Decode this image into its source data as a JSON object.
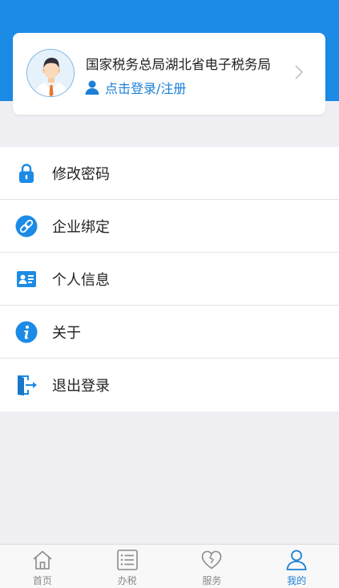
{
  "colors": {
    "brand_blue": "#1b8be6",
    "link_blue": "#1b7fd6",
    "background": "#efeff4",
    "tab_inactive": "#8a8a8a"
  },
  "profile": {
    "org_name": "国家税务总局湖北省电子税务局",
    "login_text": "点击登录/注册",
    "avatar_icon": "user-avatar-icon",
    "chevron_icon": "chevron-right-icon"
  },
  "menu": {
    "items": [
      {
        "label": "修改密码",
        "icon": "lock-icon"
      },
      {
        "label": "企业绑定",
        "icon": "link-icon"
      },
      {
        "label": "个人信息",
        "icon": "id-card-icon"
      },
      {
        "label": "关于",
        "icon": "info-icon"
      },
      {
        "label": "退出登录",
        "icon": "logout-icon"
      }
    ]
  },
  "tabbar": {
    "tabs": [
      {
        "label": "首页",
        "icon": "home-icon",
        "active": false
      },
      {
        "label": "办税",
        "icon": "list-icon",
        "active": false
      },
      {
        "label": "服务",
        "icon": "heart-icon",
        "active": false
      },
      {
        "label": "我的",
        "icon": "person-icon",
        "active": true
      }
    ]
  }
}
